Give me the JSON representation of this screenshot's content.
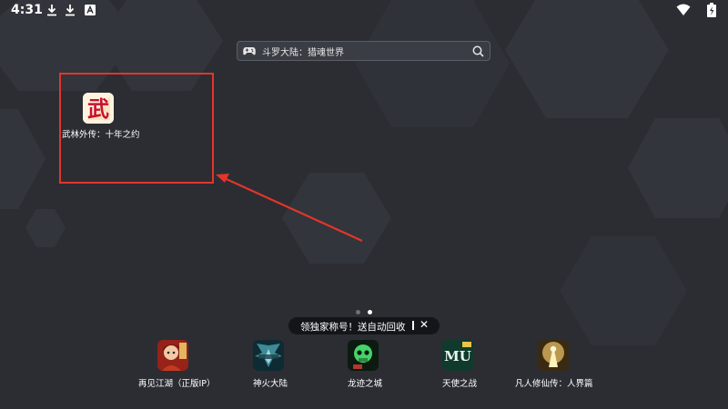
{
  "status_bar": {
    "time": "4:31",
    "left_icons": [
      "download-icon",
      "download-icon",
      "app-notification-icon"
    ],
    "right_icons": [
      "wifi-icon",
      "battery-icon"
    ]
  },
  "search": {
    "icon": "gamepad-icon",
    "text": "斗罗大陆：猎魂世界",
    "action_icon": "search-icon"
  },
  "home_apps": [
    {
      "label": "武林外传：十年之约",
      "icon_glyph": "武",
      "icon_colors": [
        "#fff6e8",
        "#c8102e"
      ]
    }
  ],
  "highlight_color": "#e3352b",
  "page_indicator": {
    "count": 2,
    "active": 1
  },
  "tooltip": {
    "text": "领独家称号！送自动回收",
    "close_glyph": "✕"
  },
  "dock_apps": [
    {
      "label": "再见江湖（正版IP）",
      "icon": "character-portrait"
    },
    {
      "label": "神火大陆",
      "icon": "winged-warrior"
    },
    {
      "label": "龙迹之城",
      "icon": "green-skull"
    },
    {
      "label": "天使之战",
      "icon": "mu-logo"
    },
    {
      "label": "凡人修仙传：人界篇",
      "icon": "golden-immortal"
    }
  ]
}
